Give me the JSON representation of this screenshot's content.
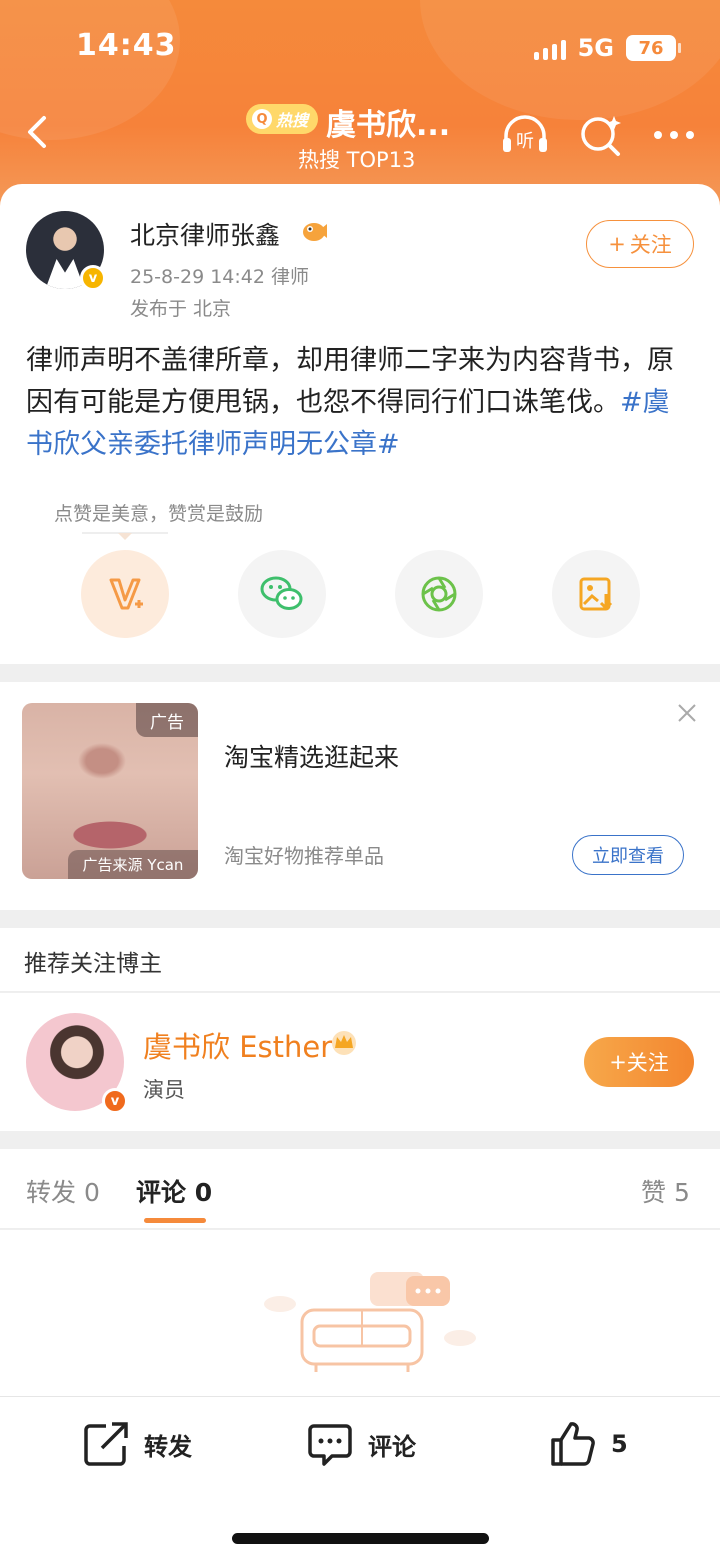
{
  "status": {
    "time": "14:43",
    "network": "5G",
    "battery": "76"
  },
  "nav": {
    "badge": "热搜",
    "title": "虞书欣...",
    "subtitle": "热搜 TOP13"
  },
  "post": {
    "author": "北京律师张鑫",
    "meta": "25-8-29 14:42  律师",
    "location": "发布于 北京",
    "follow_label": "关注",
    "text": "律师声明不盖律所章，却用律师二字来为内容背书，原因有可能是方便甩锅，也怨不得同行们口诛笔伐。",
    "hashtag": "#虞书欣父亲委托律师声明无公章#",
    "reward_hint": "点赞是美意，赞赏是鼓励"
  },
  "share_icons": [
    "reward-icon",
    "wechat-icon",
    "moments-icon",
    "save-image-icon"
  ],
  "ad": {
    "tag": "广告",
    "source": "广告来源 Ycan",
    "title": "淘宝精选逛起来",
    "desc": "淘宝好物推荐单品",
    "button": "立即查看"
  },
  "recommend": {
    "header": "推荐关注博主",
    "name": "虞书欣 Esther",
    "role": "演员",
    "follow_label": "关注"
  },
  "tabs": {
    "repost": "转发",
    "repost_count": "0",
    "comment": "评论",
    "comment_count": "0",
    "like": "赞",
    "like_count": "5"
  },
  "bottom": {
    "repost": "转发",
    "comment": "评论",
    "like_count": "5"
  },
  "colors": {
    "brand_orange": "#f58a3b",
    "link_blue": "#3a73c9"
  }
}
